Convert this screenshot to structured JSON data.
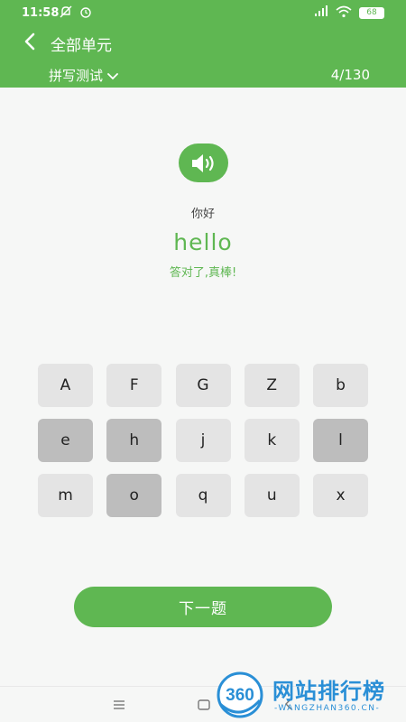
{
  "status": {
    "time": "11:58",
    "battery": "68"
  },
  "header": {
    "title": "全部单元",
    "mode": "拼写测试",
    "progress": "4/130"
  },
  "word": {
    "meaning": "你好",
    "answer": "hello",
    "feedback": "答对了,真棒!"
  },
  "keys": [
    {
      "label": "A",
      "used": false
    },
    {
      "label": "F",
      "used": false
    },
    {
      "label": "G",
      "used": false
    },
    {
      "label": "Z",
      "used": false
    },
    {
      "label": "b",
      "used": false
    },
    {
      "label": "e",
      "used": true
    },
    {
      "label": "h",
      "used": true
    },
    {
      "label": "j",
      "used": false
    },
    {
      "label": "k",
      "used": false
    },
    {
      "label": "l",
      "used": true
    },
    {
      "label": "m",
      "used": false
    },
    {
      "label": "o",
      "used": true
    },
    {
      "label": "q",
      "used": false
    },
    {
      "label": "u",
      "used": false
    },
    {
      "label": "x",
      "used": false
    }
  ],
  "actions": {
    "next": "下一题"
  },
  "watermark": {
    "logo": "360",
    "title": "网站排行榜",
    "subtitle": "-WANGZHAN360.CN-"
  },
  "colors": {
    "accent": "#5fb752",
    "key": "#e4e4e4",
    "key_used": "#bdbdbd",
    "watermark": "#2a8fd6"
  }
}
